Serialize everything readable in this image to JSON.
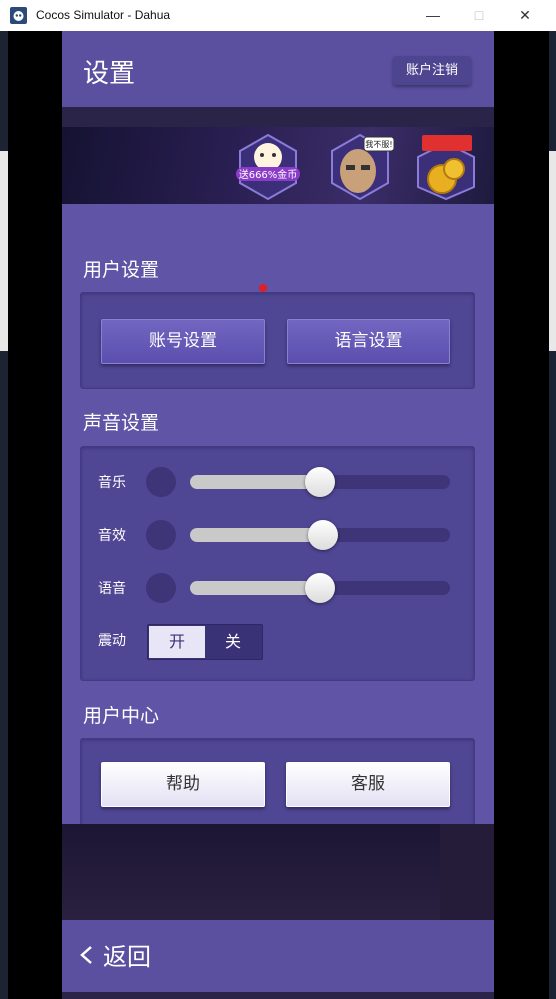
{
  "window": {
    "title": "Cocos Simulator - Dahua"
  },
  "header": {
    "title": "设置",
    "logout_label": "账户注销"
  },
  "banner": {
    "items": [
      {
        "name": "lucky-cat",
        "text": "送666%金币"
      },
      {
        "name": "face",
        "text": "我不服!"
      },
      {
        "name": "coins",
        "text": ""
      }
    ]
  },
  "user_settings": {
    "title": "用户设置",
    "account_label": "账号设置",
    "language_label": "语言设置",
    "account_has_notification": true
  },
  "sound_settings": {
    "title": "声音设置",
    "sliders": [
      {
        "label": "音乐",
        "value": 0.5
      },
      {
        "label": "音效",
        "value": 0.51
      },
      {
        "label": "语音",
        "value": 0.5
      }
    ],
    "vibration": {
      "label": "震动",
      "on_label": "开",
      "off_label": "关",
      "selected": "开"
    }
  },
  "user_center": {
    "title": "用户中心",
    "help_label": "帮助",
    "service_label": "客服"
  },
  "footer": {
    "back_label": "返回"
  }
}
